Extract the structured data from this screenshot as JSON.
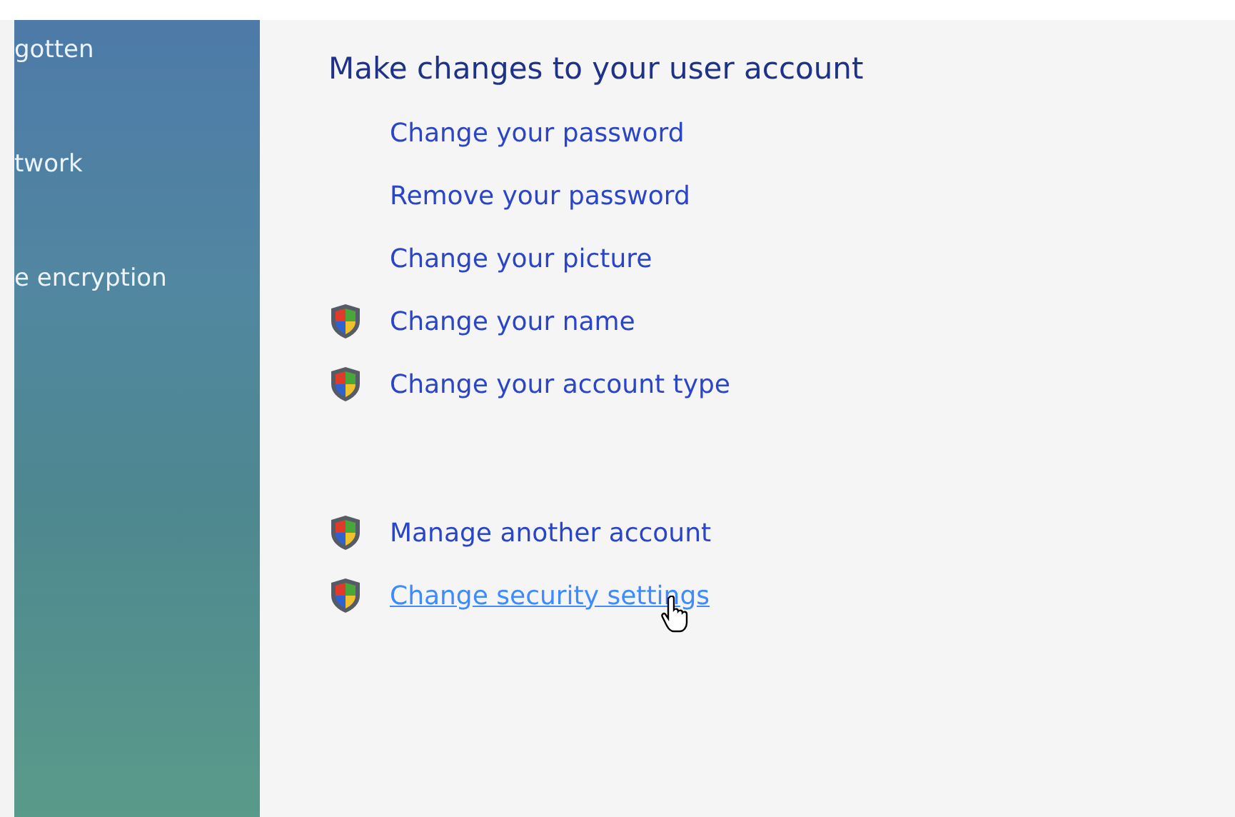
{
  "sidebar": {
    "items": [
      {
        "label": "gotten"
      },
      {
        "label": "twork"
      },
      {
        "label": "e encryption"
      }
    ]
  },
  "main": {
    "title": "Make changes to your user account",
    "groups": [
      {
        "tasks": [
          {
            "label": "Change your password",
            "shield": false,
            "hovered": false
          },
          {
            "label": "Remove your password",
            "shield": false,
            "hovered": false
          },
          {
            "label": "Change your picture",
            "shield": false,
            "hovered": false
          },
          {
            "label": "Change your name",
            "shield": true,
            "hovered": false
          },
          {
            "label": "Change your account type",
            "shield": true,
            "hovered": false
          }
        ]
      },
      {
        "tasks": [
          {
            "label": "Manage another account",
            "shield": true,
            "hovered": false
          },
          {
            "label": "Change security settings",
            "shield": true,
            "hovered": true
          }
        ]
      }
    ]
  }
}
